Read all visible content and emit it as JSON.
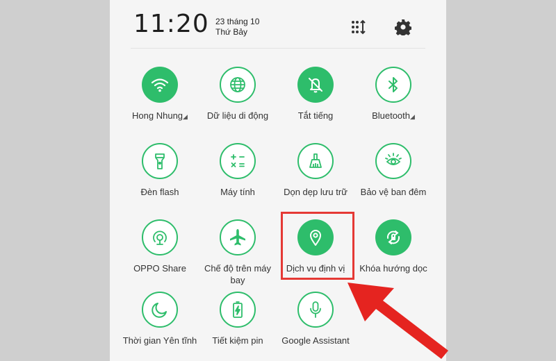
{
  "status": {
    "time": "11:20",
    "date": "23 tháng 10",
    "weekday": "Thứ Bảy"
  },
  "header_icons": [
    "grid-sort-icon",
    "settings-gear-icon"
  ],
  "colors": {
    "accent": "#2ebd6b",
    "highlight": "#e53935"
  },
  "tiles": [
    {
      "label": "Hong Nhung",
      "icon": "wifi-icon",
      "active": true,
      "has_more": true
    },
    {
      "label": "Dữ liệu di động",
      "icon": "globe-icon",
      "active": false
    },
    {
      "label": "Tắt tiếng",
      "icon": "bell-off-icon",
      "active": true
    },
    {
      "label": "Bluetooth",
      "icon": "bluetooth-icon",
      "active": false,
      "has_more": true
    },
    {
      "label": "Đèn flash",
      "icon": "flashlight-icon",
      "active": false
    },
    {
      "label": "Máy tính",
      "icon": "calculator-icon",
      "active": false
    },
    {
      "label": "Dọn dẹp lưu trữ",
      "icon": "broom-icon",
      "active": false
    },
    {
      "label": "Bảo vệ ban đêm",
      "icon": "eye-protection-icon",
      "active": false
    },
    {
      "label": "OPPO Share",
      "icon": "share-radar-icon",
      "active": false
    },
    {
      "label": "Chế độ trên máy bay",
      "icon": "airplane-icon",
      "active": false
    },
    {
      "label": "Dịch vụ định vị",
      "icon": "location-pin-icon",
      "active": true
    },
    {
      "label": "Khóa hướng dọc",
      "icon": "rotation-lock-icon",
      "active": false
    },
    {
      "label": "Thời gian Yên tĩnh",
      "icon": "moon-icon",
      "active": false
    },
    {
      "label": "Tiết kiệm pin",
      "icon": "battery-saver-icon",
      "active": false
    },
    {
      "label": "Google Assistant",
      "icon": "microphone-icon",
      "active": false
    }
  ]
}
